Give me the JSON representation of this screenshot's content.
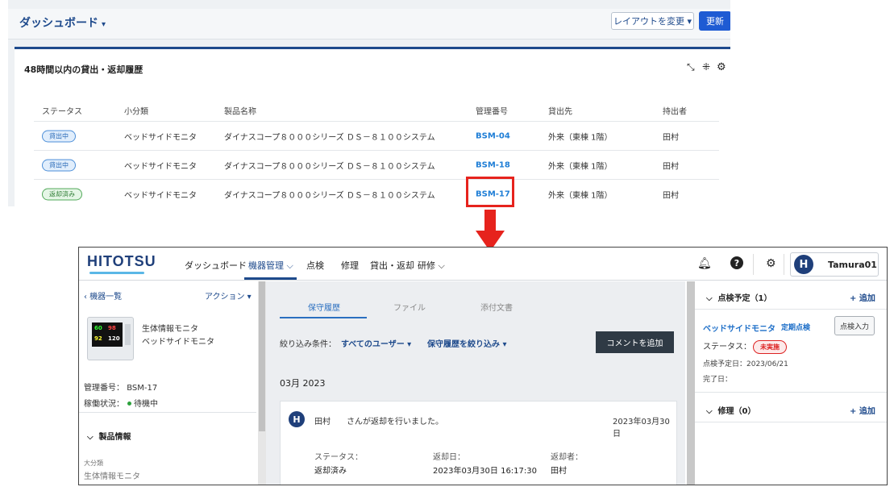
{
  "dashboard": {
    "title": "ダッシュボード",
    "caret": "▾",
    "layout_button": "レイアウトを変更 ▾",
    "update_button": "更新",
    "card_title": "48時間以内の貸出・返却履歴",
    "columns": [
      "ステータス",
      "小分類",
      "製品名称",
      "管理番号",
      "貸出先",
      "持出者"
    ],
    "rows": [
      {
        "status": "貸出中",
        "subcategory": "ベッドサイドモニタ",
        "product": "ダイナスコープ８０００シリーズ ＤＳ－８１００システム",
        "mgmt_no": "BSM-04",
        "destination": "外来（東棟 1階）",
        "holder": "田村"
      },
      {
        "status": "貸出中",
        "subcategory": "ベッドサイドモニタ",
        "product": "ダイナスコープ８０００シリーズ ＤＳ－８１００システム",
        "mgmt_no": "BSM-18",
        "destination": "外来（東棟 1階）",
        "holder": "田村"
      },
      {
        "status": "返却済み",
        "subcategory": "ベッドサイドモニタ",
        "product": "ダイナスコープ８０００シリーズ ＤＳ－８１００システム",
        "mgmt_no": "BSM-17",
        "destination": "外来（東棟 1階）",
        "holder": "田村"
      }
    ],
    "icons": {
      "expand": "expand-arrows-icon",
      "collapse": "collapse-icon",
      "settings": "gear-icon"
    }
  },
  "app": {
    "logo": "HITOTSU",
    "nav": [
      "ダッシュボード",
      "機器管理",
      "点検",
      "修理",
      "貸出・返却",
      "研修"
    ],
    "nav_caret": "⌵",
    "user_initial": "H",
    "user_name": "Tamura01",
    "left": {
      "back": "機器一覧",
      "action": "アクション ▾",
      "device_line1": "生体情報モニタ",
      "device_line2": "ベッドサイドモニタ",
      "mgmt_label": "管理番号：",
      "mgmt_value": "BSM-17",
      "oper_label": "稼働状況：",
      "oper_value": "待機中",
      "section_product": "製品情報",
      "category_label": "大分類",
      "category_value": "生体情報モニタ"
    },
    "center": {
      "tabs": [
        "保守履歴",
        "ファイル",
        "添付文書"
      ],
      "filter_label": "絞り込み条件：",
      "filter_users": "すべてのユーザー ▾",
      "filter_history": "保守履歴を絞り込み ▾",
      "comment_button": "コメントを追加",
      "month": "03月 2023",
      "entry": {
        "avatar": "H",
        "user": "田村",
        "message": "さんが返却を行いました。",
        "date": "2023年03月30日",
        "fields": [
          {
            "label": "ステータス：",
            "value": "返却済み"
          },
          {
            "label": "返却日：",
            "value": "2023年03月30日 16:17:30"
          },
          {
            "label": "返却者：",
            "value": "田村"
          }
        ]
      }
    },
    "right": {
      "inspection_header": "点検予定（1）",
      "add": "+ 追加",
      "device_name": "ベッドサイドモニタ",
      "inspection_type": "定期点検",
      "inspection_button": "点検入力",
      "status_label": "ステータス：",
      "status_value": "未実施",
      "planned": "点検予定日：2023/06/21",
      "completed": "完了日：",
      "repair_header": "修理（0）"
    }
  },
  "colors": {
    "highlight": "#e6231d",
    "brand": "#1e4a8c",
    "link": "#1f7ed6"
  }
}
